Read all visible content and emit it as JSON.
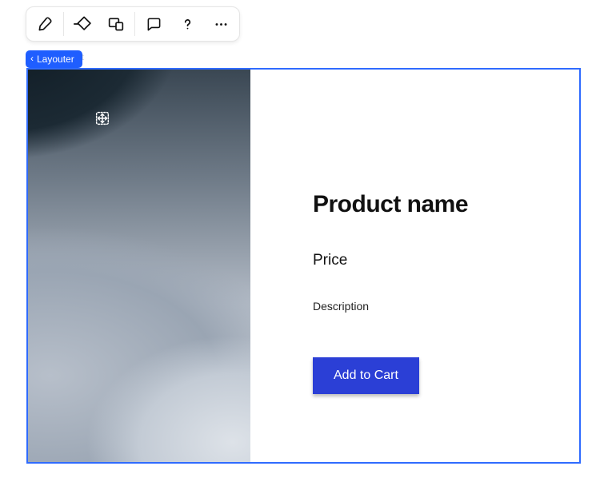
{
  "toolbar": {
    "items": [
      {
        "name": "brush-icon",
        "group": 0
      },
      {
        "name": "diamond-icon",
        "group": 1
      },
      {
        "name": "responsive-icon",
        "group": 1
      },
      {
        "name": "comment-icon",
        "group": 2
      },
      {
        "name": "help-icon",
        "group": 2
      },
      {
        "name": "more-icon",
        "group": 2
      }
    ]
  },
  "breadcrumb": {
    "label": "Layouter",
    "ghost": "ct"
  },
  "frame": {
    "move_handle_name": "move-handle"
  },
  "product": {
    "title": "Product name",
    "price": "Price",
    "description": "Description",
    "cta": "Add to Cart"
  },
  "colors": {
    "selection": "#2f6bff",
    "breadcrumb": "#1f5eff",
    "cta": "#2b3fd6"
  }
}
